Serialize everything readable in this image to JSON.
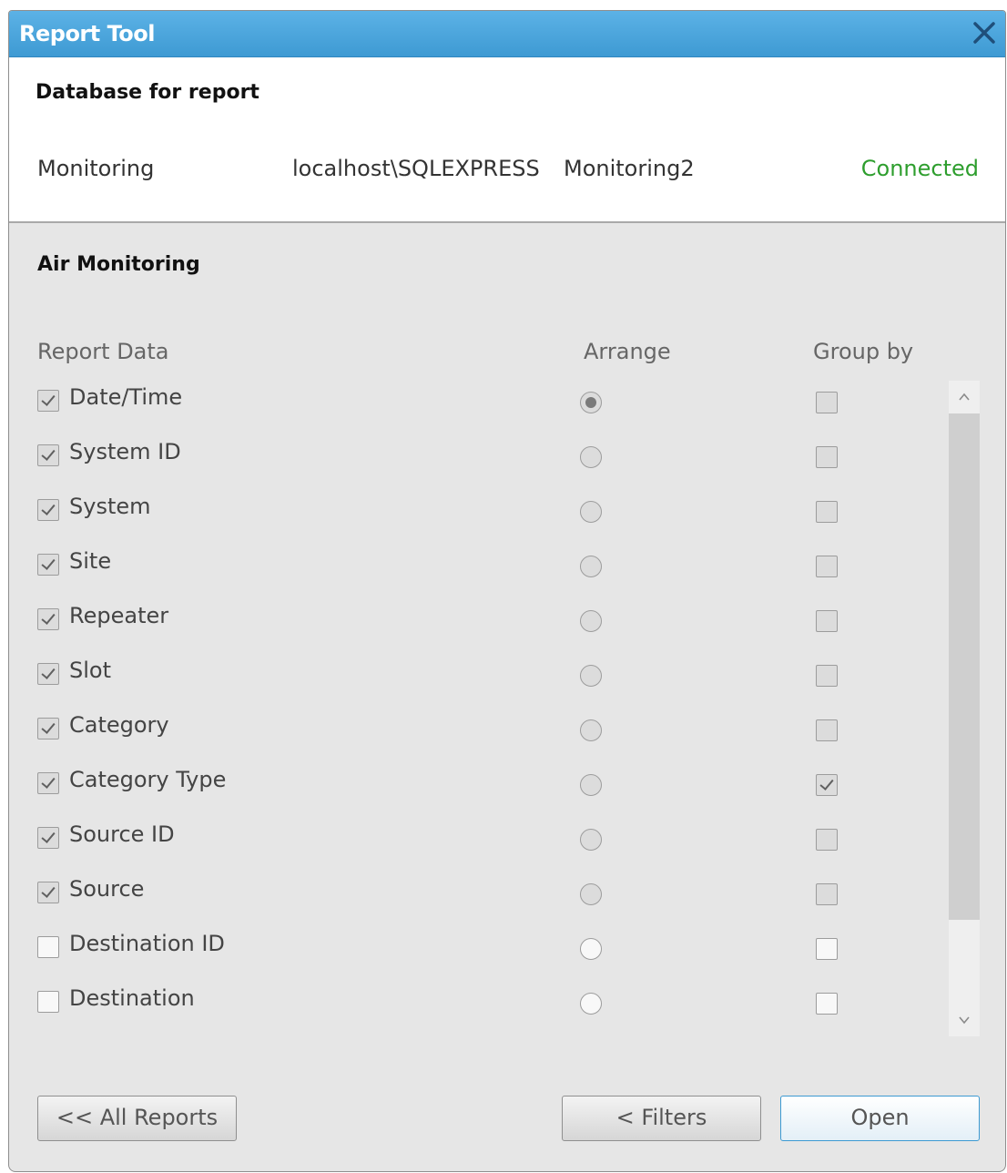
{
  "window": {
    "title": "Report Tool"
  },
  "database": {
    "heading": "Database for report",
    "name": "Monitoring",
    "server": "localhost\\SQLEXPRESS",
    "db": "Monitoring2",
    "status": "Connected"
  },
  "section": {
    "heading": "Air Monitoring",
    "col_report": "Report Data",
    "col_arrange": "Arrange",
    "col_group": "Group by"
  },
  "rows": [
    {
      "label": "Date/Time",
      "checked": true,
      "arrange": true,
      "group": false
    },
    {
      "label": "System ID",
      "checked": true,
      "arrange": false,
      "group": false
    },
    {
      "label": "System",
      "checked": true,
      "arrange": false,
      "group": false
    },
    {
      "label": "Site",
      "checked": true,
      "arrange": false,
      "group": false
    },
    {
      "label": "Repeater",
      "checked": true,
      "arrange": false,
      "group": false
    },
    {
      "label": "Slot",
      "checked": true,
      "arrange": false,
      "group": false
    },
    {
      "label": "Category",
      "checked": true,
      "arrange": false,
      "group": false
    },
    {
      "label": "Category Type",
      "checked": true,
      "arrange": false,
      "group": true
    },
    {
      "label": "Source ID",
      "checked": true,
      "arrange": false,
      "group": false
    },
    {
      "label": "Source",
      "checked": true,
      "arrange": false,
      "group": false
    },
    {
      "label": "Destination ID",
      "checked": false,
      "arrange": false,
      "group": false
    },
    {
      "label": "Destination",
      "checked": false,
      "arrange": false,
      "group": false
    }
  ],
  "buttons": {
    "all_reports": "<< All Reports",
    "filters": "< Filters",
    "open": "Open"
  },
  "colors": {
    "titlebar": "#4aa6de",
    "connected": "#2e9e2e"
  }
}
